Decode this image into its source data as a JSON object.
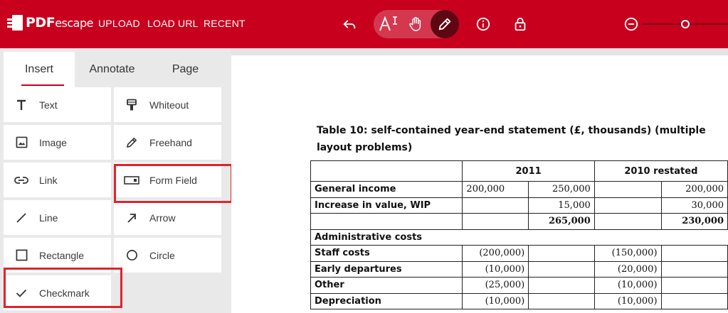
{
  "header": {
    "logo_bold": "PDF",
    "logo_rest": "escape",
    "nav": [
      "UPLOAD",
      "LOAD URL",
      "RECENT"
    ],
    "brand_color": "#c8001e",
    "icons": [
      "undo-icon",
      "text-select-icon",
      "pan-hand-icon",
      "edit-pencil-icon",
      "info-icon",
      "lock-icon",
      "zoom-out-icon",
      "zoom-slider-handle"
    ]
  },
  "sidebar": {
    "tabs": [
      {
        "label": "Insert",
        "active": true
      },
      {
        "label": "Annotate",
        "active": false
      },
      {
        "label": "Page",
        "active": false
      }
    ],
    "tools": [
      {
        "label": "Text",
        "icon": "text-icon"
      },
      {
        "label": "Whiteout",
        "icon": "whiteout-icon"
      },
      {
        "label": "Image",
        "icon": "image-icon"
      },
      {
        "label": "Freehand",
        "icon": "pencil-icon"
      },
      {
        "label": "Link",
        "icon": "link-icon"
      },
      {
        "label": "Form Field",
        "icon": "form-field-icon",
        "highlighted": true
      },
      {
        "label": "Line",
        "icon": "line-icon"
      },
      {
        "label": "Arrow",
        "icon": "arrow-icon"
      },
      {
        "label": "Rectangle",
        "icon": "rectangle-icon"
      },
      {
        "label": "Circle",
        "icon": "circle-icon"
      },
      {
        "label": "Checkmark",
        "icon": "checkmark-icon",
        "highlighted": true
      }
    ],
    "highlight_color": "#e0242c"
  },
  "document": {
    "title_line1": "Table 10: self-contained year-end statement (£, thousands) (multiple",
    "title_line2": "layout problems)",
    "header_2011": "2011",
    "header_2010": "2010 restated",
    "rows": [
      {
        "label": "General income",
        "c1": "200,000",
        "c2": "250,000",
        "c3": "",
        "c4": "200,000"
      },
      {
        "label": "Increase in value, WIP",
        "c1": "",
        "c2": "15,000",
        "c3": "",
        "c4": "30,000"
      },
      {
        "label": "",
        "c1": "",
        "c2": "265,000",
        "c3": "",
        "c4": "230,000"
      },
      {
        "label": "Administrative costs",
        "c1": "",
        "c2": "",
        "c3": "",
        "c4": ""
      },
      {
        "label": "Staff costs",
        "c1": "(200,000)",
        "c2": "",
        "c3": "(150,000)",
        "c4": ""
      },
      {
        "label": "Early departures",
        "c1": "(10,000)",
        "c2": "",
        "c3": "(20,000)",
        "c4": ""
      },
      {
        "label": "Other",
        "c1": "(25,000)",
        "c2": "",
        "c3": "(10,000)",
        "c4": ""
      },
      {
        "label": "Depreciation",
        "c1": "(10,000)",
        "c2": "",
        "c3": "(10,000)",
        "c4": ""
      }
    ]
  }
}
